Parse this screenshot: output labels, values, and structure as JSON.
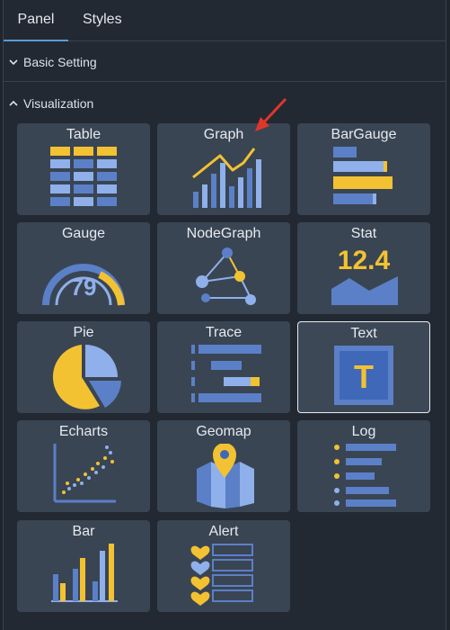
{
  "tabs": [
    {
      "label": "Panel",
      "active": true
    },
    {
      "label": "Styles",
      "active": false
    }
  ],
  "sections": {
    "basic": {
      "label": "Basic Setting",
      "expanded": false
    },
    "visualization": {
      "label": "Visualization",
      "expanded": true
    }
  },
  "visualizations": [
    {
      "label": "Table",
      "icon": "table-icon"
    },
    {
      "label": "Graph",
      "icon": "graph-icon"
    },
    {
      "label": "BarGauge",
      "icon": "bar-gauge-icon"
    },
    {
      "label": "Gauge",
      "icon": "gauge-icon",
      "value": "79"
    },
    {
      "label": "NodeGraph",
      "icon": "node-graph-icon"
    },
    {
      "label": "Stat",
      "icon": "stat-icon",
      "value": "12.4"
    },
    {
      "label": "Pie",
      "icon": "pie-icon"
    },
    {
      "label": "Trace",
      "icon": "trace-icon"
    },
    {
      "label": "Text",
      "icon": "text-icon",
      "glyph": "T",
      "selected": true
    },
    {
      "label": "Echarts",
      "icon": "echarts-icon"
    },
    {
      "label": "Geomap",
      "icon": "geomap-icon"
    },
    {
      "label": "Log",
      "icon": "log-icon"
    },
    {
      "label": "Bar",
      "icon": "bar-icon"
    },
    {
      "label": "Alert",
      "icon": "alert-icon"
    }
  ],
  "colors": {
    "blue": "#5b80c8",
    "light_blue": "#8fb0ea",
    "yellow": "#f2c232",
    "orange": "#f29f3a",
    "red_arrow": "#e0362b",
    "accent_tab": "#5a9bd5"
  }
}
